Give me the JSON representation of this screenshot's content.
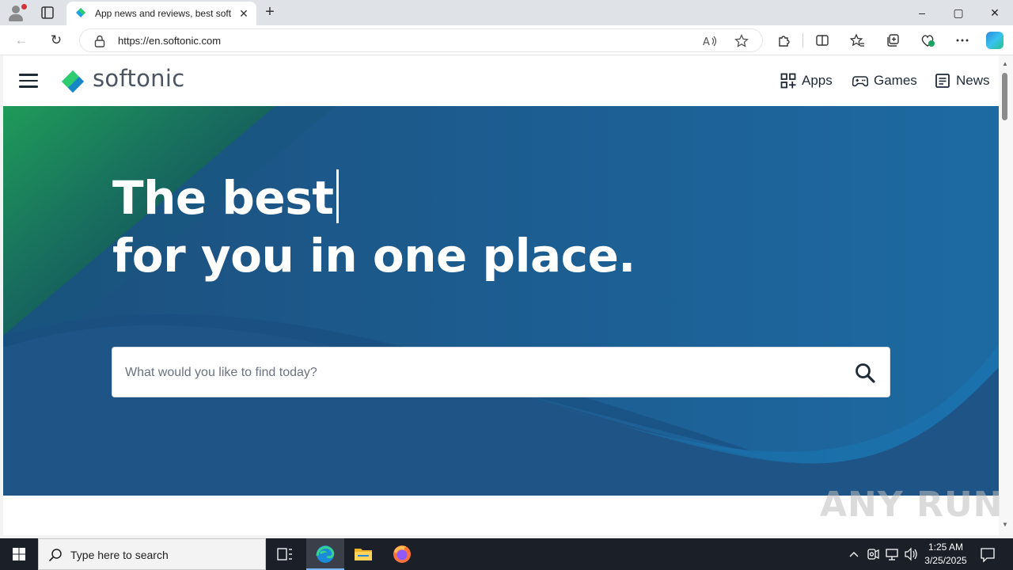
{
  "browser": {
    "tab": {
      "title": "App news and reviews, best software downloads and discovery - Softonic",
      "close": "✕"
    },
    "new_tab": "+",
    "window": {
      "minimize": "–",
      "maximize": "▢",
      "close": "✕"
    },
    "address": {
      "url": "https://en.softonic.com"
    },
    "nav": {
      "back": "←",
      "refresh": "↻"
    }
  },
  "site": {
    "logo_text": "softonic",
    "nav": [
      {
        "label": "Apps",
        "icon": "grid-icon"
      },
      {
        "label": "Games",
        "icon": "gamepad-icon"
      },
      {
        "label": "News",
        "icon": "newspaper-icon"
      }
    ],
    "hero": {
      "line1": "The best",
      "line2": "for you in one place.",
      "search_placeholder": "What would you like to find today?"
    },
    "colors": {
      "hero_blue": "#1e5f94",
      "accent_green": "#1fa05a",
      "logo_green": "#2ecc71",
      "logo_blue": "#1ba1e2"
    }
  },
  "watermark": "ANY RUN",
  "taskbar": {
    "search_placeholder": "Type here to search",
    "clock_time": "1:25 AM",
    "clock_date": "3/25/2025"
  }
}
